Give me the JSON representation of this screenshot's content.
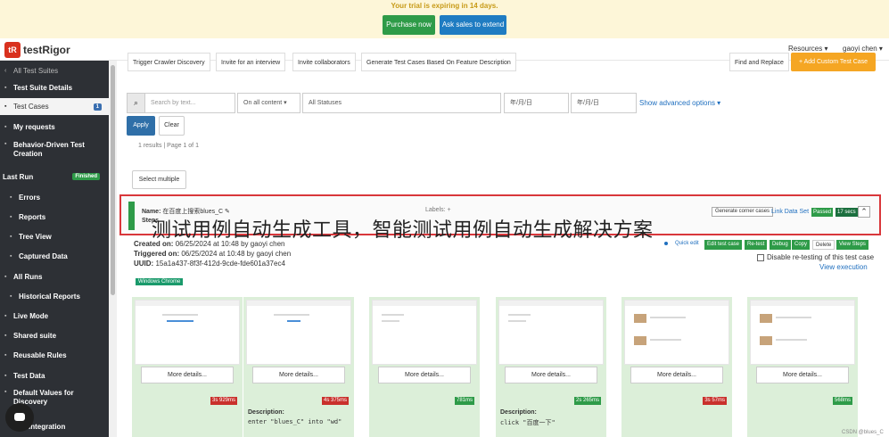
{
  "banner": {
    "message": "Your trial is expiring in 14 days.",
    "purchase_label": "Purchase now",
    "sales_label": "Ask sales to extend"
  },
  "navbar": {
    "logo_mark": "tR",
    "logo_text": "testRigor",
    "resources": "Resources ▾",
    "user": "gaoyi chen ▾"
  },
  "sidebar": {
    "back": "All Test Suites",
    "items": [
      {
        "label": "Test Suite Details"
      },
      {
        "label": "Test Cases",
        "badge": "1"
      },
      {
        "label": "My requests"
      },
      {
        "label": "Behavior-Driven Test Creation"
      },
      {
        "label": "Last Run",
        "badge": "Finished"
      },
      {
        "label": "Errors"
      },
      {
        "label": "Reports"
      },
      {
        "label": "Tree View"
      },
      {
        "label": "Captured Data"
      },
      {
        "label": "All Runs"
      },
      {
        "label": "Historical Reports"
      },
      {
        "label": "Live Mode"
      },
      {
        "label": "Shared suite"
      },
      {
        "label": "Reusable Rules"
      },
      {
        "label": "Test Data"
      },
      {
        "label": "Default Values for Discovery"
      },
      {
        "label": "Integration"
      }
    ]
  },
  "toolbar": {
    "trigger": "Trigger Crawler Discovery",
    "invite_interview": "Invite for an interview",
    "invite_collab": "Invite collaborators",
    "generate": "Generate Test Cases Based On Feature Description",
    "find_replace": "Find and Replace",
    "add_custom": "+ Add Custom Test Case"
  },
  "filters": {
    "search_placeholder": "Search by text...",
    "content": "On all content ▾",
    "statuses": "All Statuses",
    "date1": "年/月/日",
    "date2": "年/月/日",
    "advanced": "Show advanced options ▾",
    "apply": "Apply",
    "clear": "Clear",
    "results": "1 results | Page 1 of 1",
    "select_multiple": "Select multiple"
  },
  "testcase": {
    "name_label": "Name:",
    "name_value": "在百度上搜索blues_C",
    "steps_label": "Steps",
    "labels_label": "Labels:",
    "labels_plus": "+",
    "gen_corner": "Generate corner cases",
    "link_ds": "Link Data Set",
    "passed": "Passed",
    "secs": "17 secs",
    "collapse": "⌃"
  },
  "overlay": {
    "title": "测试用例自动生成工具，智能测试用例自动生成解决方案"
  },
  "meta": {
    "created_label": "Created on:",
    "created_value": "06/25/2024 at 10:48",
    "created_by": "by gaoyi chen",
    "triggered_label": "Triggered on:",
    "triggered_value": "06/25/2024 at 10:48",
    "triggered_by": "by gaoyi chen",
    "uuid_label": "UUID:",
    "uuid_value": "15a1a437-8f3f-412d-9cde-fde601a37ec4",
    "chrome": "Windows Chrome"
  },
  "actions": {
    "quick_edit": "Quick edit",
    "edit": "Edit test case",
    "retest": "Re-test",
    "debug": "Debug",
    "copy": "Copy",
    "delete": "Delete",
    "view_steps": "View Steps",
    "disable": "Disable re-testing of this test case",
    "view_exec": "View execution"
  },
  "steps": [
    {
      "more": "More details...",
      "time": "3s 929ms",
      "time_color": "red",
      "desc_label": "",
      "desc_value": ""
    },
    {
      "more": "More details...",
      "time": "4s 375ms",
      "time_color": "red",
      "desc_label": "Description:",
      "desc_value": "enter \"blues_C\" into \"wd\""
    },
    {
      "more": "More details...",
      "time": "781ms",
      "time_color": "green",
      "desc_label": "",
      "desc_value": ""
    },
    {
      "more": "More details...",
      "time": "2s 265ms",
      "time_color": "green",
      "desc_label": "Description:",
      "desc_value": "click \"百度一下\""
    },
    {
      "more": "More details...",
      "time": "3s 57ms",
      "time_color": "red",
      "desc_label": "",
      "desc_value": ""
    },
    {
      "more": "More details...",
      "time": "568ms",
      "time_color": "green",
      "desc_label": "",
      "desc_value": ""
    }
  ],
  "footer": {
    "csdn": "CSDN @blues_C"
  },
  "colors": {
    "accent": "#2e9b48",
    "brand": "#d9311e",
    "highlight": "#d9373b"
  }
}
